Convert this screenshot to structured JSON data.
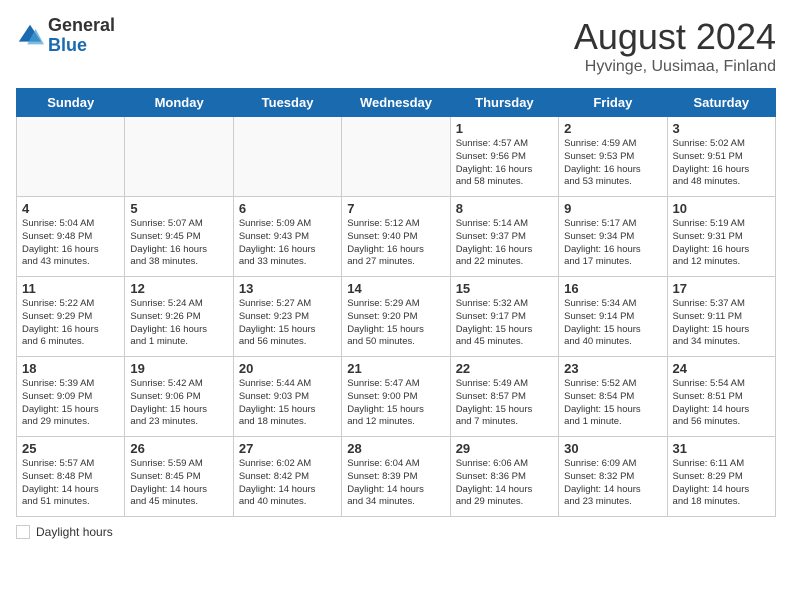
{
  "header": {
    "logo_general": "General",
    "logo_blue": "Blue",
    "month_title": "August 2024",
    "location": "Hyvinge, Uusimaa, Finland"
  },
  "weekdays": [
    "Sunday",
    "Monday",
    "Tuesday",
    "Wednesday",
    "Thursday",
    "Friday",
    "Saturday"
  ],
  "legend": {
    "label": "Daylight hours"
  },
  "weeks": [
    [
      {
        "day": "",
        "info": ""
      },
      {
        "day": "",
        "info": ""
      },
      {
        "day": "",
        "info": ""
      },
      {
        "day": "",
        "info": ""
      },
      {
        "day": "1",
        "info": "Sunrise: 4:57 AM\nSunset: 9:56 PM\nDaylight: 16 hours\nand 58 minutes."
      },
      {
        "day": "2",
        "info": "Sunrise: 4:59 AM\nSunset: 9:53 PM\nDaylight: 16 hours\nand 53 minutes."
      },
      {
        "day": "3",
        "info": "Sunrise: 5:02 AM\nSunset: 9:51 PM\nDaylight: 16 hours\nand 48 minutes."
      }
    ],
    [
      {
        "day": "4",
        "info": "Sunrise: 5:04 AM\nSunset: 9:48 PM\nDaylight: 16 hours\nand 43 minutes."
      },
      {
        "day": "5",
        "info": "Sunrise: 5:07 AM\nSunset: 9:45 PM\nDaylight: 16 hours\nand 38 minutes."
      },
      {
        "day": "6",
        "info": "Sunrise: 5:09 AM\nSunset: 9:43 PM\nDaylight: 16 hours\nand 33 minutes."
      },
      {
        "day": "7",
        "info": "Sunrise: 5:12 AM\nSunset: 9:40 PM\nDaylight: 16 hours\nand 27 minutes."
      },
      {
        "day": "8",
        "info": "Sunrise: 5:14 AM\nSunset: 9:37 PM\nDaylight: 16 hours\nand 22 minutes."
      },
      {
        "day": "9",
        "info": "Sunrise: 5:17 AM\nSunset: 9:34 PM\nDaylight: 16 hours\nand 17 minutes."
      },
      {
        "day": "10",
        "info": "Sunrise: 5:19 AM\nSunset: 9:31 PM\nDaylight: 16 hours\nand 12 minutes."
      }
    ],
    [
      {
        "day": "11",
        "info": "Sunrise: 5:22 AM\nSunset: 9:29 PM\nDaylight: 16 hours\nand 6 minutes."
      },
      {
        "day": "12",
        "info": "Sunrise: 5:24 AM\nSunset: 9:26 PM\nDaylight: 16 hours\nand 1 minute."
      },
      {
        "day": "13",
        "info": "Sunrise: 5:27 AM\nSunset: 9:23 PM\nDaylight: 15 hours\nand 56 minutes."
      },
      {
        "day": "14",
        "info": "Sunrise: 5:29 AM\nSunset: 9:20 PM\nDaylight: 15 hours\nand 50 minutes."
      },
      {
        "day": "15",
        "info": "Sunrise: 5:32 AM\nSunset: 9:17 PM\nDaylight: 15 hours\nand 45 minutes."
      },
      {
        "day": "16",
        "info": "Sunrise: 5:34 AM\nSunset: 9:14 PM\nDaylight: 15 hours\nand 40 minutes."
      },
      {
        "day": "17",
        "info": "Sunrise: 5:37 AM\nSunset: 9:11 PM\nDaylight: 15 hours\nand 34 minutes."
      }
    ],
    [
      {
        "day": "18",
        "info": "Sunrise: 5:39 AM\nSunset: 9:09 PM\nDaylight: 15 hours\nand 29 minutes."
      },
      {
        "day": "19",
        "info": "Sunrise: 5:42 AM\nSunset: 9:06 PM\nDaylight: 15 hours\nand 23 minutes."
      },
      {
        "day": "20",
        "info": "Sunrise: 5:44 AM\nSunset: 9:03 PM\nDaylight: 15 hours\nand 18 minutes."
      },
      {
        "day": "21",
        "info": "Sunrise: 5:47 AM\nSunset: 9:00 PM\nDaylight: 15 hours\nand 12 minutes."
      },
      {
        "day": "22",
        "info": "Sunrise: 5:49 AM\nSunset: 8:57 PM\nDaylight: 15 hours\nand 7 minutes."
      },
      {
        "day": "23",
        "info": "Sunrise: 5:52 AM\nSunset: 8:54 PM\nDaylight: 15 hours\nand 1 minute."
      },
      {
        "day": "24",
        "info": "Sunrise: 5:54 AM\nSunset: 8:51 PM\nDaylight: 14 hours\nand 56 minutes."
      }
    ],
    [
      {
        "day": "25",
        "info": "Sunrise: 5:57 AM\nSunset: 8:48 PM\nDaylight: 14 hours\nand 51 minutes."
      },
      {
        "day": "26",
        "info": "Sunrise: 5:59 AM\nSunset: 8:45 PM\nDaylight: 14 hours\nand 45 minutes."
      },
      {
        "day": "27",
        "info": "Sunrise: 6:02 AM\nSunset: 8:42 PM\nDaylight: 14 hours\nand 40 minutes."
      },
      {
        "day": "28",
        "info": "Sunrise: 6:04 AM\nSunset: 8:39 PM\nDaylight: 14 hours\nand 34 minutes."
      },
      {
        "day": "29",
        "info": "Sunrise: 6:06 AM\nSunset: 8:36 PM\nDaylight: 14 hours\nand 29 minutes."
      },
      {
        "day": "30",
        "info": "Sunrise: 6:09 AM\nSunset: 8:32 PM\nDaylight: 14 hours\nand 23 minutes."
      },
      {
        "day": "31",
        "info": "Sunrise: 6:11 AM\nSunset: 8:29 PM\nDaylight: 14 hours\nand 18 minutes."
      }
    ]
  ]
}
